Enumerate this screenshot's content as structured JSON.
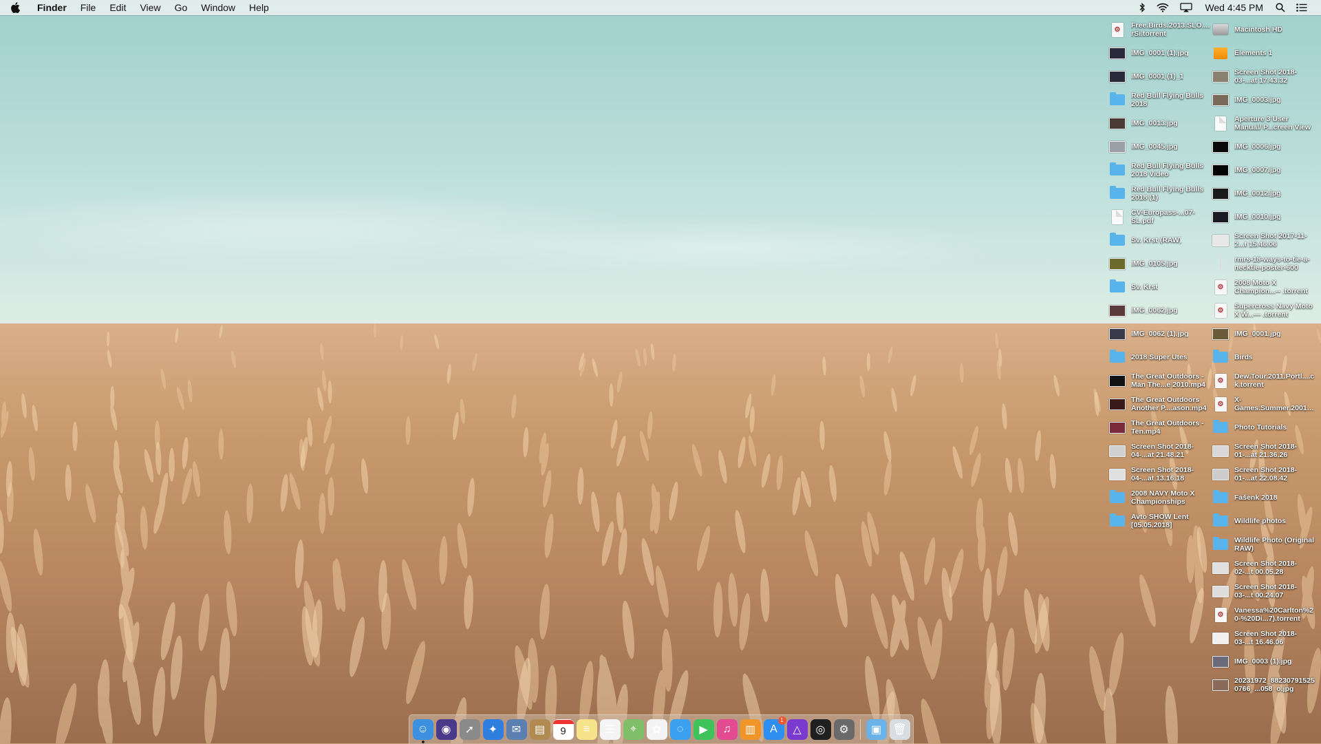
{
  "menubar": {
    "app_name": "Finder",
    "menus": [
      "File",
      "Edit",
      "View",
      "Go",
      "Window",
      "Help"
    ],
    "clock": "Wed 4:45 PM",
    "status_icons": [
      "bluetooth-icon",
      "wifi-icon",
      "airplay-icon",
      "spotlight-search-icon",
      "notification-center-icon"
    ]
  },
  "desktop": {
    "column_1": [
      {
        "label": "Free.Birds.2013.SLO....rSi.torrent",
        "type": "torrent"
      },
      {
        "label": "IMG_0001 (1).jpg",
        "type": "image",
        "color": "#2a2a3a"
      },
      {
        "label": "IMG_0001 (1)_1",
        "type": "image",
        "color": "#2a2a3a"
      },
      {
        "label": "Red Bull Flying Bulls 2018",
        "type": "folder"
      },
      {
        "label": "IMG_0013.jpg",
        "type": "image",
        "color": "#4a3b35"
      },
      {
        "label": "IMG_0045.jpg",
        "type": "image",
        "color": "#9aa0a6"
      },
      {
        "label": "Red Bull Flying Bulls 2018 Video",
        "type": "folder"
      },
      {
        "label": "Red Bull Flying Bulls 2018 (1)",
        "type": "folder"
      },
      {
        "label": "CV-Europass-...07-SL.pdf",
        "type": "doc"
      },
      {
        "label": "Sv. Krst (RAW)",
        "type": "folder"
      },
      {
        "label": "IMG_0105.jpg",
        "type": "image",
        "color": "#6b6a2a"
      },
      {
        "label": "Sv. Krst",
        "type": "folder"
      },
      {
        "label": "IMG_0062.jpg",
        "type": "image",
        "color": "#5a3a3a"
      },
      {
        "label": "IMG_0062 (1).jpg",
        "type": "image",
        "color": "#3a3a4a"
      },
      {
        "label": "2018 Super Utes",
        "type": "folder"
      },
      {
        "label": "The Great Outdoors - Man The...e 2010.mp4",
        "type": "image",
        "color": "#111111"
      },
      {
        "label": "The Great Outdoors Another P....ason.mp4",
        "type": "image",
        "color": "#3a1a1a"
      },
      {
        "label": "The Great Outdoors - Ten.mp4",
        "type": "image",
        "color": "#7a2a3a"
      },
      {
        "label": "Screen Shot 2018-04-...at 21.48.21",
        "type": "image",
        "color": "#d0d0d0"
      },
      {
        "label": "Screen Shot 2018-04-...at 13.16.18",
        "type": "image",
        "color": "#e0e0e0"
      },
      {
        "label": "2008 NAVY Moto X Championships",
        "type": "folder"
      },
      {
        "label": "Avto SHOW Lent [05.05.2018]",
        "type": "folder"
      }
    ],
    "column_2": [
      {
        "label": "Macintosh HD",
        "type": "hd"
      },
      {
        "label": "Elements 1",
        "type": "external"
      },
      {
        "label": "Screen Shot 2018-03-...at 17.43.32",
        "type": "image",
        "color": "#8a8070"
      },
      {
        "label": "IMG_0003.jpg",
        "type": "image",
        "color": "#7a6a5a"
      },
      {
        "label": "Aperture 3 User Manual/ P...creen View",
        "type": "doc"
      },
      {
        "label": "IMG_0006.jpg",
        "type": "image",
        "color": "#0a0a0a"
      },
      {
        "label": "IMG_0007.jpg",
        "type": "image",
        "color": "#050505"
      },
      {
        "label": "IMG_0012.jpg",
        "type": "image",
        "color": "#1a1a1a"
      },
      {
        "label": "IMG_0010.jpg",
        "type": "image",
        "color": "#1a1a22"
      },
      {
        "label": "Screen Shot 2017-11-2...t 15.46.06",
        "type": "image",
        "color": "#e8e8e8"
      },
      {
        "label": "rmrs-18-ways-to-tie-a-necktie-poster-600",
        "type": "line"
      },
      {
        "label": "2008 Moto X Champion...-- .torrent",
        "type": "torrent"
      },
      {
        "label": "Supercross Navy Moto X W...--- .torrent",
        "type": "torrent"
      },
      {
        "label": "IMG_0001.jpg",
        "type": "image",
        "color": "#6a5a3a"
      },
      {
        "label": "Birds",
        "type": "folder"
      },
      {
        "label": "Dew.Tour.2011.Portl....ck.torrent",
        "type": "torrent"
      },
      {
        "label": "X-Games.Summer.2001-200...XV.torrent",
        "type": "torrent"
      },
      {
        "label": "Photo Tutorials",
        "type": "folder"
      },
      {
        "label": "Screen Shot 2018-01-...at 21.36.26",
        "type": "image",
        "color": "#d8d8d8"
      },
      {
        "label": "Screen Shot 2018-01-...at 22.08.42",
        "type": "image",
        "color": "#cccccc"
      },
      {
        "label": "Fašenk 2018",
        "type": "folder"
      },
      {
        "label": "Wildlife photos",
        "type": "folder"
      },
      {
        "label": "Wildlife Photo (Original RAW)",
        "type": "folder"
      },
      {
        "label": "Screen Shot 2018-02-...t 00.05.28",
        "type": "image",
        "color": "#e0e0e0"
      },
      {
        "label": "Screen Shot 2018-03-...t 00.24.07",
        "type": "image",
        "color": "#dddddd"
      },
      {
        "label": "Vanessa%20Carlton%20-%20Di...7).torrent",
        "type": "torrent"
      },
      {
        "label": "Screen Shot 2018-03-...t 16.46.06",
        "type": "image",
        "color": "#f0f0f0"
      },
      {
        "label": "IMG_0003 (1).jpg",
        "type": "image",
        "color": "#6a6a7a"
      },
      {
        "label": "20231972_882307915250766_...058_o.jpg",
        "type": "image",
        "color": "#8a6a5a"
      }
    ]
  },
  "dock": {
    "calendar_day": "9",
    "appstore_badge": "1",
    "apps": [
      {
        "name": "finder-app-icon",
        "color": "#3d8fe0",
        "glyph": "☺",
        "running": true
      },
      {
        "name": "siri-app-icon",
        "color": "#4a3a8a",
        "glyph": "◉"
      },
      {
        "name": "launchpad-app-icon",
        "color": "#8a8a8a",
        "glyph": "➚"
      },
      {
        "name": "safari-app-icon",
        "color": "#2f7fe0",
        "glyph": "✦"
      },
      {
        "name": "mail-stamp-app-icon",
        "color": "#5a7fb0",
        "glyph": "✉"
      },
      {
        "name": "notes-book-app-icon",
        "color": "#b08a50",
        "glyph": "▤"
      },
      {
        "name": "calendar-app-icon",
        "color": "#ffffff",
        "glyph": "cal"
      },
      {
        "name": "notes-app-icon",
        "color": "#f7e48a",
        "glyph": "≡"
      },
      {
        "name": "reminders-app-icon",
        "color": "#f4f4f4",
        "glyph": "☰"
      },
      {
        "name": "maps-app-icon",
        "color": "#7fbf6a",
        "glyph": "⌖"
      },
      {
        "name": "photos-app-icon",
        "color": "#f4f4f4",
        "glyph": "✿"
      },
      {
        "name": "messages-app-icon",
        "color": "#3aa0ef",
        "glyph": "◌"
      },
      {
        "name": "facetime-app-icon",
        "color": "#3ec25a",
        "glyph": "▶"
      },
      {
        "name": "itunes-app-icon",
        "color": "#e24b8f",
        "glyph": "♫"
      },
      {
        "name": "ibooks-app-icon",
        "color": "#f0952a",
        "glyph": "▥"
      },
      {
        "name": "app-store-app-icon",
        "color": "#2f8ff0",
        "glyph": "A"
      },
      {
        "name": "affinity-photo-app-icon",
        "color": "#7a3ad0",
        "glyph": "△"
      },
      {
        "name": "aperture-app-icon",
        "color": "#202020",
        "glyph": "◎"
      },
      {
        "name": "system-preferences-app-icon",
        "color": "#6a6a6a",
        "glyph": "⚙"
      }
    ],
    "trailing": [
      {
        "name": "downloads-stack-icon",
        "color": "#6ab2e8",
        "glyph": "▣"
      },
      {
        "name": "trash-icon",
        "color": "#d8dde2",
        "glyph": "🗑"
      }
    ]
  }
}
